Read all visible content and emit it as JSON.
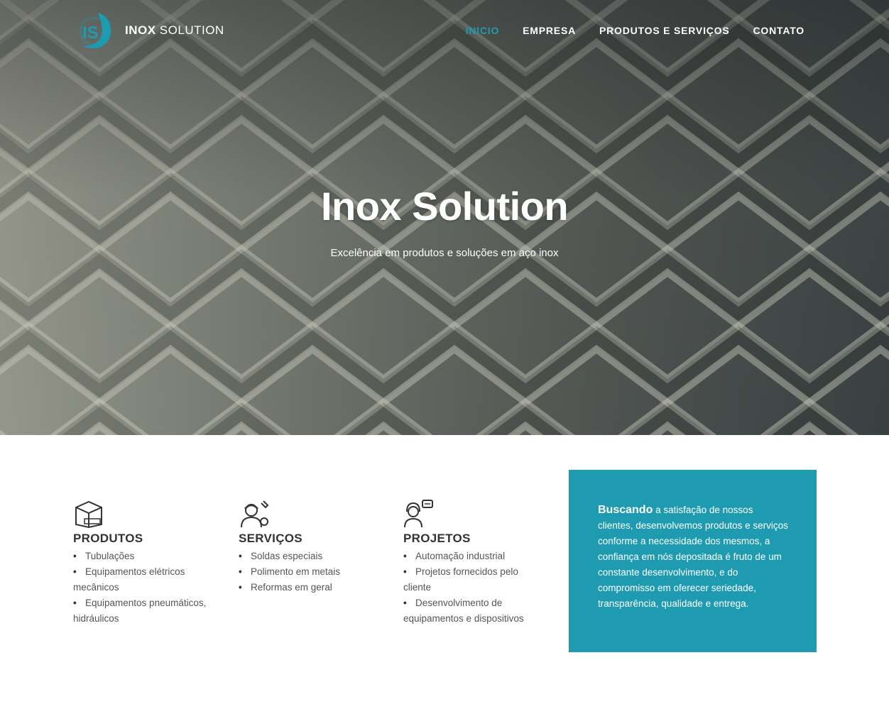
{
  "brand": {
    "logo_initials": "IS",
    "name_bold": "INOX",
    "name_regular": "SOLUTION",
    "accent_color": "#1e9bb0"
  },
  "nav": {
    "items": [
      {
        "label": "INICIO",
        "active": true
      },
      {
        "label": "EMPRESA",
        "active": false
      },
      {
        "label": "PRODUTOS E SERVIÇOS",
        "active": false
      },
      {
        "label": "CONTATO",
        "active": false
      }
    ]
  },
  "hero": {
    "title": "Inox Solution",
    "subtitle": "Excelência em produtos e soluções em aço inox"
  },
  "sections": [
    {
      "icon": "box-icon",
      "title": "PRODUTOS",
      "items": [
        "Tubulações",
        "Equipamentos elétricos mecânicos",
        "Equipamentos pneumáticos, hidráulicos"
      ]
    },
    {
      "icon": "worker-wrench-icon",
      "title": "SERVIÇOS",
      "items": [
        "Soldas especiais",
        "Polimento em metais",
        "Reformas em geral"
      ]
    },
    {
      "icon": "support-agent-icon",
      "title": "PROJETOS",
      "items": [
        "Automação industrial",
        "Projetos fornecidos pelo cliente",
        "Desenvolvimento de equipamentos e dispositivos"
      ]
    }
  ],
  "mission": {
    "lead": "Buscando",
    "text": "a satisfação de nossos clientes, desenvolvemos produtos e serviços conforme a necessidade dos mesmos, a confiança em nós depositada é fruto de um constante desenvolvimento, e do compromisso em oferecer seriedade, transparência, qualidade e entrega."
  }
}
